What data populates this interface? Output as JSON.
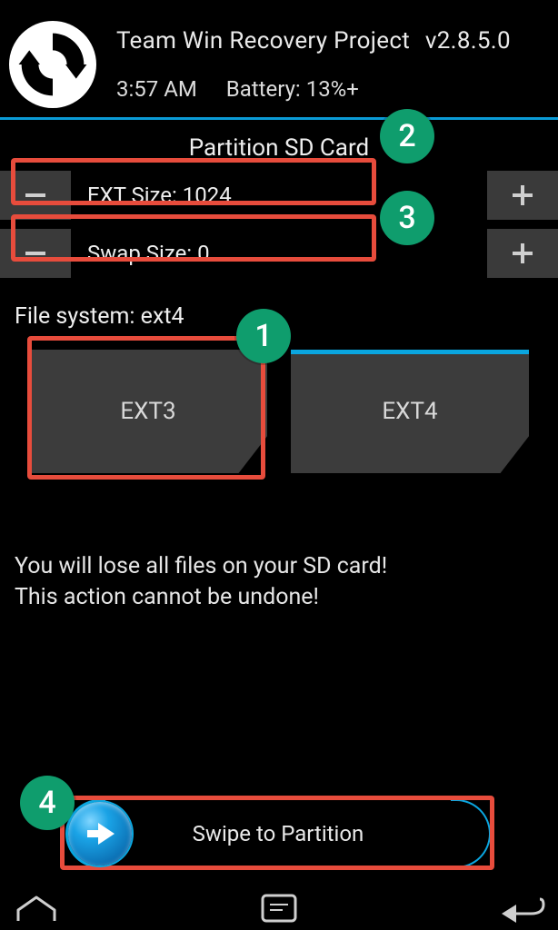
{
  "annotation_badges": {
    "b1": "1",
    "b2": "2",
    "b3": "3",
    "b4": "4"
  },
  "header": {
    "app_name": "Team Win Recovery Project",
    "version": "v2.8.5.0",
    "time": "3:57 AM",
    "battery": "Battery: 13%+",
    "icon": "twrp-logo"
  },
  "page": {
    "title": "Partition SD Card",
    "file_system_line": "File system: ext4",
    "warning_line1": "You will lose all files on your SD card!",
    "warning_line2": "This action cannot be undone!"
  },
  "steppers": {
    "ext": {
      "label": "EXT Size: 1024",
      "minus_icon": "minus-icon",
      "plus_icon": "plus-icon"
    },
    "swap": {
      "label": "Swap Size: 0",
      "minus_icon": "minus-icon",
      "plus_icon": "plus-icon"
    }
  },
  "tabs": {
    "ext3": {
      "label": "EXT3",
      "selected": false
    },
    "ext4": {
      "label": "EXT4",
      "selected": true
    }
  },
  "swipe": {
    "label": "Swipe to Partition",
    "knob_icon": "arrow-right-icon"
  },
  "navbar": {
    "home_icon": "home-icon",
    "terminal_icon": "terminal-icon",
    "back_icon": "back-icon"
  },
  "colors": {
    "accent": "#0aa6e0",
    "highlight": "#e74c3c",
    "badge": "#0f9d6d",
    "panel": "#3c3c3c"
  }
}
